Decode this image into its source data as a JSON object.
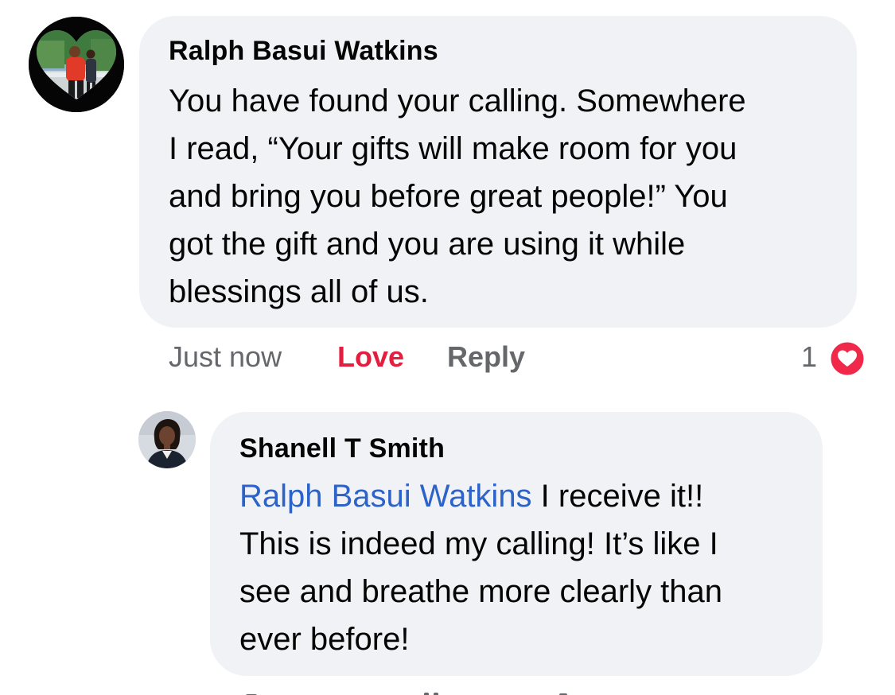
{
  "comments": [
    {
      "author": "Ralph Basui Watkins",
      "body_lines": [
        "You have found your calling. Somewhere",
        "I read, “Your gifts will make room for you",
        "and bring you before great people!”  You",
        "got the gift and you are using it while",
        "blessings all of us."
      ],
      "timestamp": "Just now",
      "love_label": "Love",
      "reply_label": "Reply",
      "reaction_count": "1",
      "reaction_icon": "heart-reaction-icon"
    }
  ],
  "reply": {
    "author": "Shanell T Smith",
    "mention": "Ralph Basui Watkins",
    "first_line_rest": " I receive it!!",
    "body_lines": [
      "This is indeed my calling! It’s like I",
      "see and breathe more clearly than",
      "ever before!"
    ]
  },
  "colors": {
    "bubble": "#f0f2f5",
    "love": "#e41e3f",
    "mention": "#2d63c8",
    "secondary_text": "#65676b"
  }
}
